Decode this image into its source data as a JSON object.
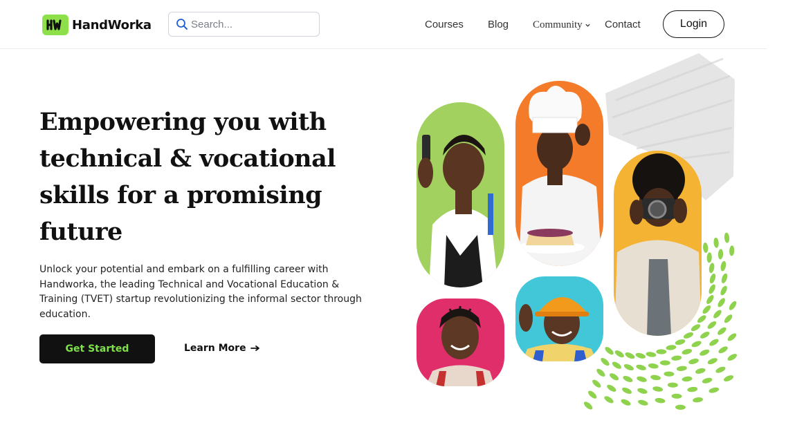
{
  "brand": {
    "name": "HandWorka",
    "logo_glyph": "HW",
    "accent_color": "#8ee04a"
  },
  "search": {
    "placeholder": "Search..."
  },
  "nav": {
    "items": [
      "Courses",
      "Blog",
      "Community",
      "Contact"
    ],
    "login_label": "Login"
  },
  "hero": {
    "title": "Empowering you with technical & vocational skills for a promising future",
    "description": "Unlock your potential and embark on a fulfilling career with Handworka, the leading Technical and Vocational Education & Training (TVET) startup revolutionizing the informal sector through education.",
    "cta_label": "Get Started",
    "learn_more_label": "Learn More"
  },
  "collage": {
    "photos": [
      {
        "subject": "barber",
        "bg_color": "#a2d15f"
      },
      {
        "subject": "chef",
        "bg_color": "#f47b2a"
      },
      {
        "subject": "photographer",
        "bg_color": "#f5b333"
      },
      {
        "subject": "woman-smiling",
        "bg_color": "#e02e6a"
      },
      {
        "subject": "construction-worker",
        "bg_color": "#41c7d8"
      }
    ],
    "dots_color": "#8fd24e",
    "brush_color": "#e2e2e2"
  }
}
